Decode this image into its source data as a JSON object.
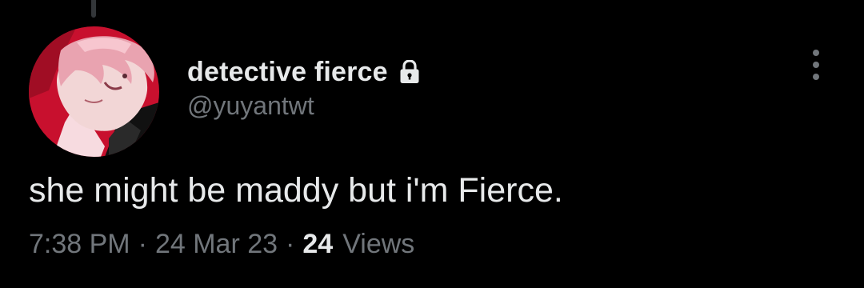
{
  "tweet": {
    "author": {
      "display_name": "detective fierce",
      "handle": "@yuyantwt",
      "protected_icon": "lock-icon",
      "avatar_icon": "profile-avatar"
    },
    "text": "she might be maddy but i'm Fierce.",
    "meta": {
      "time": "7:38 PM",
      "separator": "·",
      "date": "24 Mar 23",
      "views_count": "24",
      "views_label": "Views"
    },
    "more_options_icon": "more-vertical-icon"
  },
  "colors": {
    "background": "#000000",
    "primary_text": "#e7e9ea",
    "secondary_text": "#71767b",
    "avatar_red": "#c8102e"
  }
}
